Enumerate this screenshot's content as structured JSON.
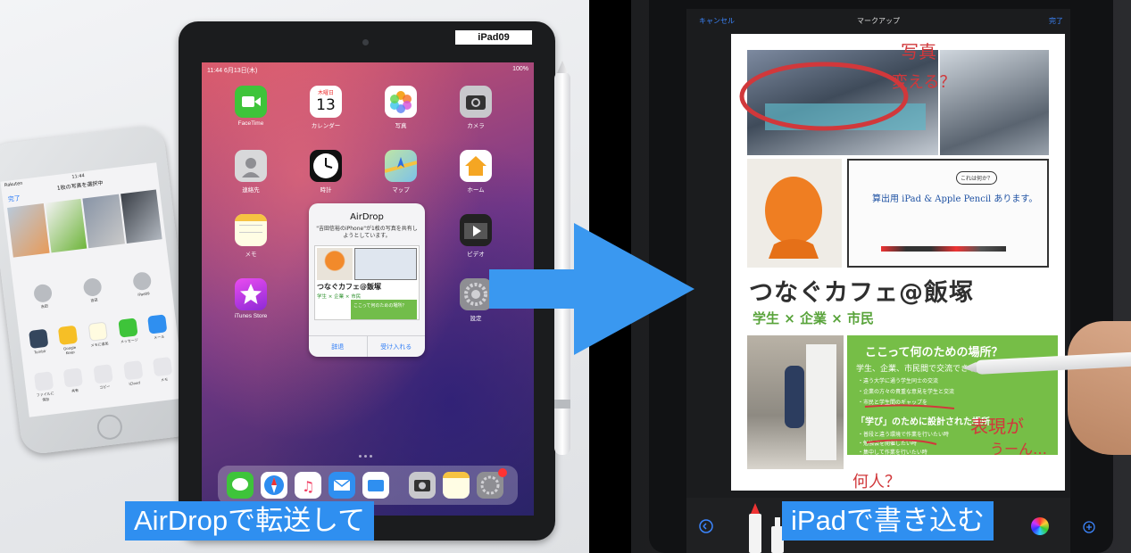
{
  "left_photo": {
    "ipad_label": "iPad09",
    "status_bar": {
      "time": "11:44",
      "date": "6月13日(木)",
      "battery": "100%"
    },
    "apps": [
      {
        "name": "FaceTime",
        "color": "#3ec43a"
      },
      {
        "name": "カレンダー",
        "color": "#ffffff"
      },
      {
        "name": "写真",
        "color": "#ffffff"
      },
      {
        "name": "カメラ",
        "color": "#c8c8cc"
      },
      {
        "name": "連絡先",
        "color": "#d8d8da"
      },
      {
        "name": "時計",
        "color": "#111111"
      },
      {
        "name": "マップ",
        "color": "#7cc1e8"
      },
      {
        "name": "ホーム",
        "color": "#f5a623"
      },
      {
        "name": "メモ",
        "color": "#fffde4"
      },
      {
        "name": "ビデオ",
        "color": "#222222"
      },
      {
        "name": "iTunes Store",
        "color": "#c23ee0"
      },
      {
        "name": "設定",
        "color": "#8e8e93"
      }
    ],
    "calendar_day": "木曜日",
    "calendar_date": "13",
    "airdrop": {
      "title": "AirDrop",
      "description": "\"吉田信裕のiPhone\"が1枚の写真を共有しようとしています。",
      "preview_title": "つなぐカフェ@飯塚",
      "preview_subtitle": "学生 × 企業 × 市民",
      "preview_green": "ここって何のための場所？",
      "decline": "辞退",
      "accept": "受け入れる"
    },
    "iphone": {
      "carrier": "Rakuten",
      "time": "11:44",
      "sheet_title": "1枚の写真を選択中",
      "done": "完了",
      "people": [
        "吉田",
        "吉田",
        "iPad09"
      ],
      "apps": [
        "Tumblr",
        "Google Keep",
        "メモに追加",
        "メッセージ",
        "メール"
      ],
      "actions": [
        "ファイルに保存",
        "共有",
        "コピー",
        "iCloud",
        "メモ"
      ]
    }
  },
  "right_photo": {
    "nav": {
      "cancel": "キャンセル",
      "title": "マークアップ",
      "done": "完了"
    },
    "doc": {
      "title": "つなぐカフェ@飯塚",
      "subtitle": "学生 × 企業 × 市民",
      "green_heading": "ここって何のための場所？",
      "green_line": "学生、企業、市民間で交流できる場所",
      "bullets": [
        "・違う大学に通う学生同士の交流",
        "・企業の方々の貴重な意見を学生と交流",
        "・市民と学生間のギャップを",
        "・普段と違う環境で作業を行いたい時",
        "・勉強会を開催したい時",
        "・集中して作業を行いたい時"
      ],
      "green_heading2": "「学び」のために設計された場所",
      "board_text": "算出用 iPad & Apple Pencil あります。",
      "board_note": "これは何か？"
    },
    "annotations": {
      "photo_note_1": "写真",
      "photo_note_2": "変える？",
      "expression_note": "表現が",
      "expression_note_2": "うーん…",
      "who_note": "何人？"
    }
  },
  "captions": {
    "left": "AirDropで転送して",
    "right": "iPadで書き込む"
  },
  "colors": {
    "caption_bg": "#2f8ff0",
    "arrow": "#3a98f0",
    "annotation_red": "#d1383b",
    "doc_green": "#76be47"
  }
}
